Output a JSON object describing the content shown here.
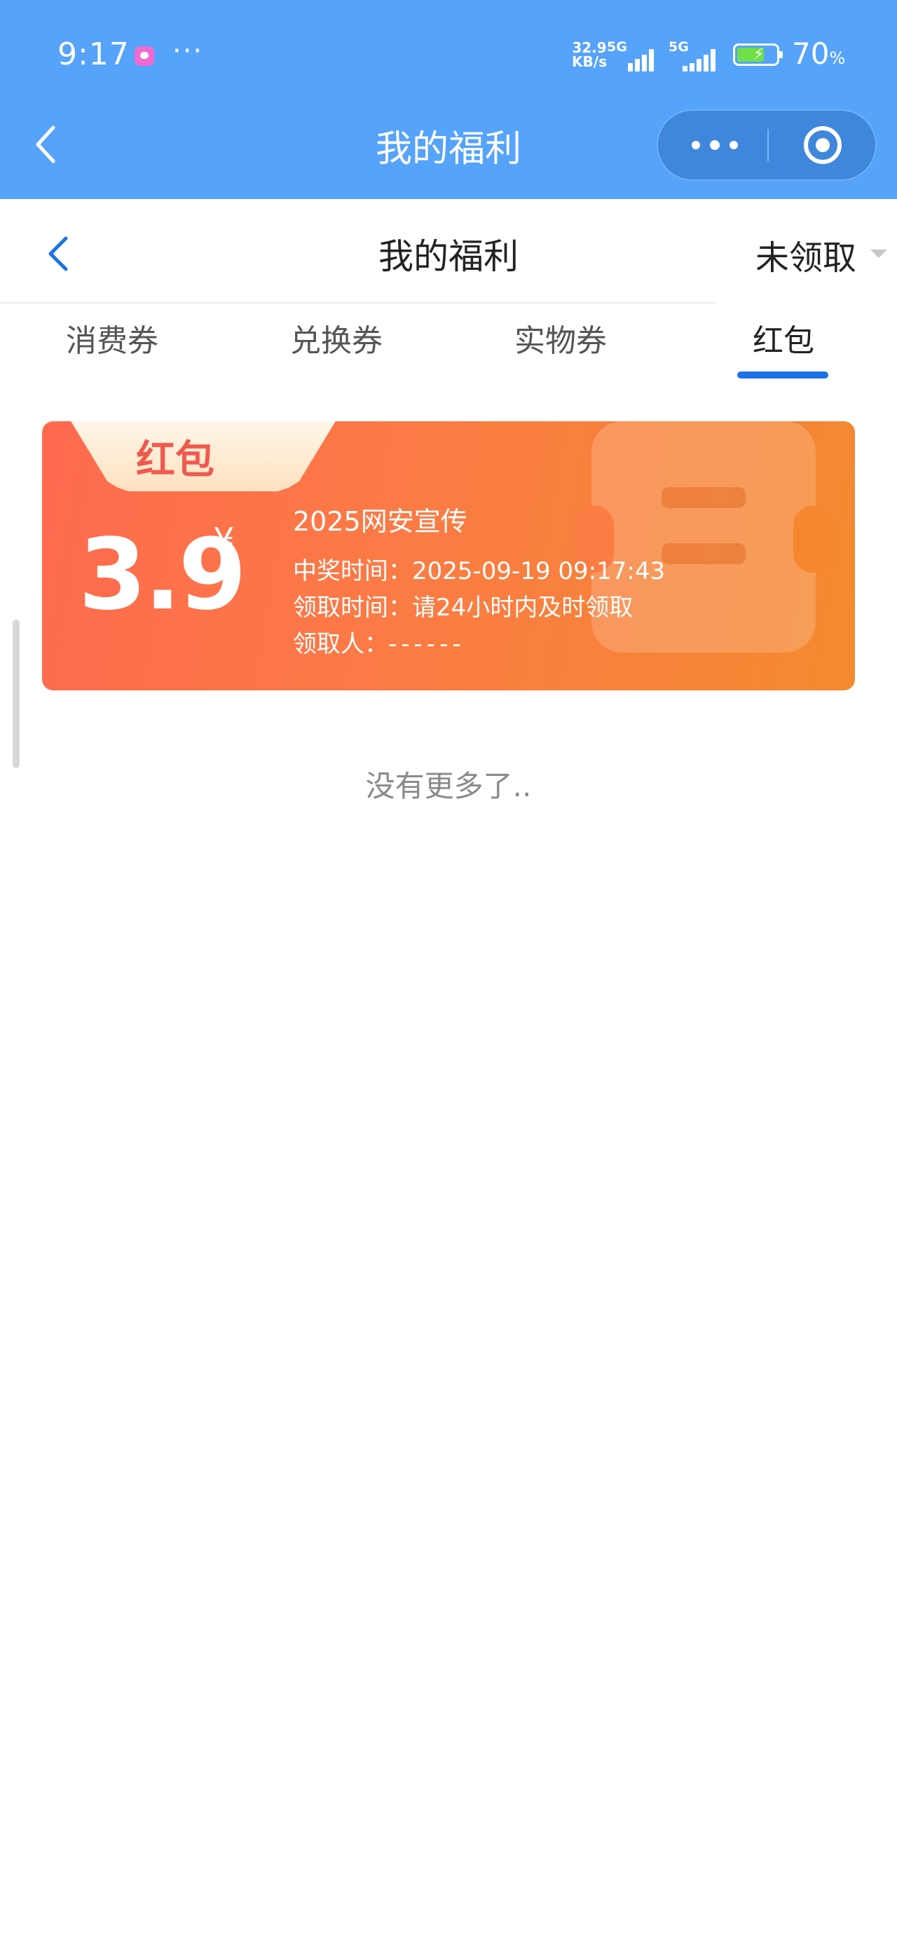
{
  "status_bar": {
    "time": "9:17",
    "dots": "···",
    "net_speed_value": "32.9",
    "net_speed_unit": "KB/s",
    "sim1_label": "5G",
    "sim2_label": "5G",
    "battery_percent": "70",
    "battery_unit": "%",
    "battery_level": 0.7,
    "battery_charging": true
  },
  "mini_program": {
    "title": "我的福利",
    "back_icon": "chevron-left-icon",
    "more_icon": "more-dots-icon",
    "close_icon": "target-circle-icon",
    "header_color": "#55a3fb"
  },
  "page_header": {
    "title": "我的福利",
    "filter_label": "未领取"
  },
  "tabs": [
    {
      "label": "消费券",
      "active": false
    },
    {
      "label": "兑换券",
      "active": false
    },
    {
      "label": "实物券",
      "active": false
    },
    {
      "label": "红包",
      "active": true
    }
  ],
  "card": {
    "tag": "红包",
    "amount": "3.9",
    "currency": "¥",
    "name": "2025网安宣传",
    "win_time_label": "中奖时间：",
    "win_time_value": "2025-09-19 09:17:43",
    "claim_time_label": "领取时间：",
    "claim_time_value": "请24小时内及时领取",
    "recipient_label": "领取人：",
    "recipient_value": "------",
    "gradient_start": "#ff6a4f",
    "gradient_end": "#f48a2f"
  },
  "footer_text": "没有更多了..",
  "accent_color": "#1b73e8"
}
